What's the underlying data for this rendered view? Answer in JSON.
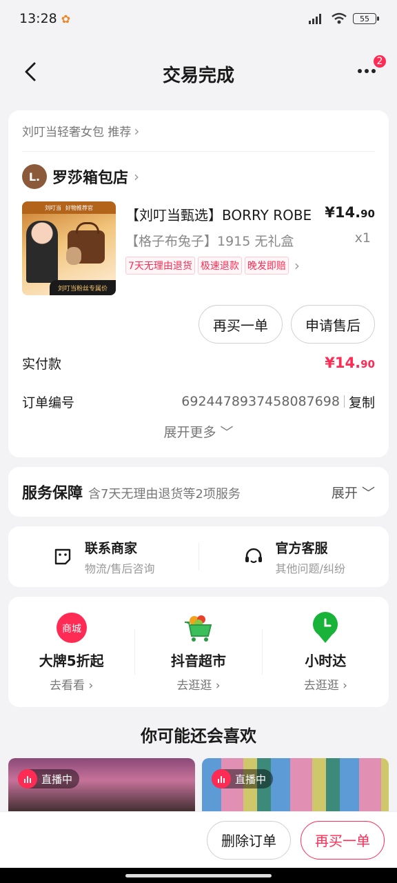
{
  "status": {
    "time": "13:28",
    "battery": "55"
  },
  "nav": {
    "title": "交易完成",
    "badge": "2"
  },
  "order": {
    "recommend": "刘叮当轻奢女包 推荐",
    "shop": {
      "initial": "L.",
      "name": "罗莎箱包店"
    },
    "product": {
      "thumb_top_left": "刘叮当",
      "thumb_top_right": "好物推荐官",
      "thumb_bottom": "刘叮当粉丝专属价",
      "title": "【刘叮当甄选】BORRY ROBE",
      "spec": "【格子布兔子】1915 无礼盒",
      "price_int": "¥14.",
      "price_dec": "90",
      "qty": "x1",
      "tags": [
        "7天无理由退货",
        "极速退款",
        "晚发即赔"
      ]
    },
    "buttons": {
      "rebuy": "再买一单",
      "after_sale": "申请售后"
    },
    "paid": {
      "label": "实付款",
      "int": "¥14.",
      "dec": "90"
    },
    "order_no": {
      "label": "订单编号",
      "value": "6924478937458087698",
      "copy": "复制"
    },
    "expand_more": "展开更多"
  },
  "service": {
    "title": "服务保障",
    "desc": "含7天无理由退货等2项服务",
    "expand": "展开"
  },
  "contact": [
    {
      "title": "联系商家",
      "sub": "物流/售后咨询",
      "icon": "merchant-chat-icon"
    },
    {
      "title": "官方客服",
      "sub": "其他问题/纠纷",
      "icon": "headset-icon"
    }
  ],
  "promos": [
    {
      "title": "大牌5折起",
      "sub": "去看看",
      "icon": "mall-icon",
      "icon_text": "商城"
    },
    {
      "title": "抖音超市",
      "sub": "去逛逛",
      "icon": "shopping-cart-icon"
    },
    {
      "title": "小时达",
      "sub": "去逛逛",
      "icon": "clock-pin-icon"
    }
  ],
  "guess": {
    "title": "你可能还会喜欢",
    "live_label": "直播中"
  },
  "bottom": {
    "delete": "删除订单",
    "rebuy": "再买一单"
  },
  "colors": {
    "accent": "#fe2c55",
    "background": "#f3f3f5"
  }
}
